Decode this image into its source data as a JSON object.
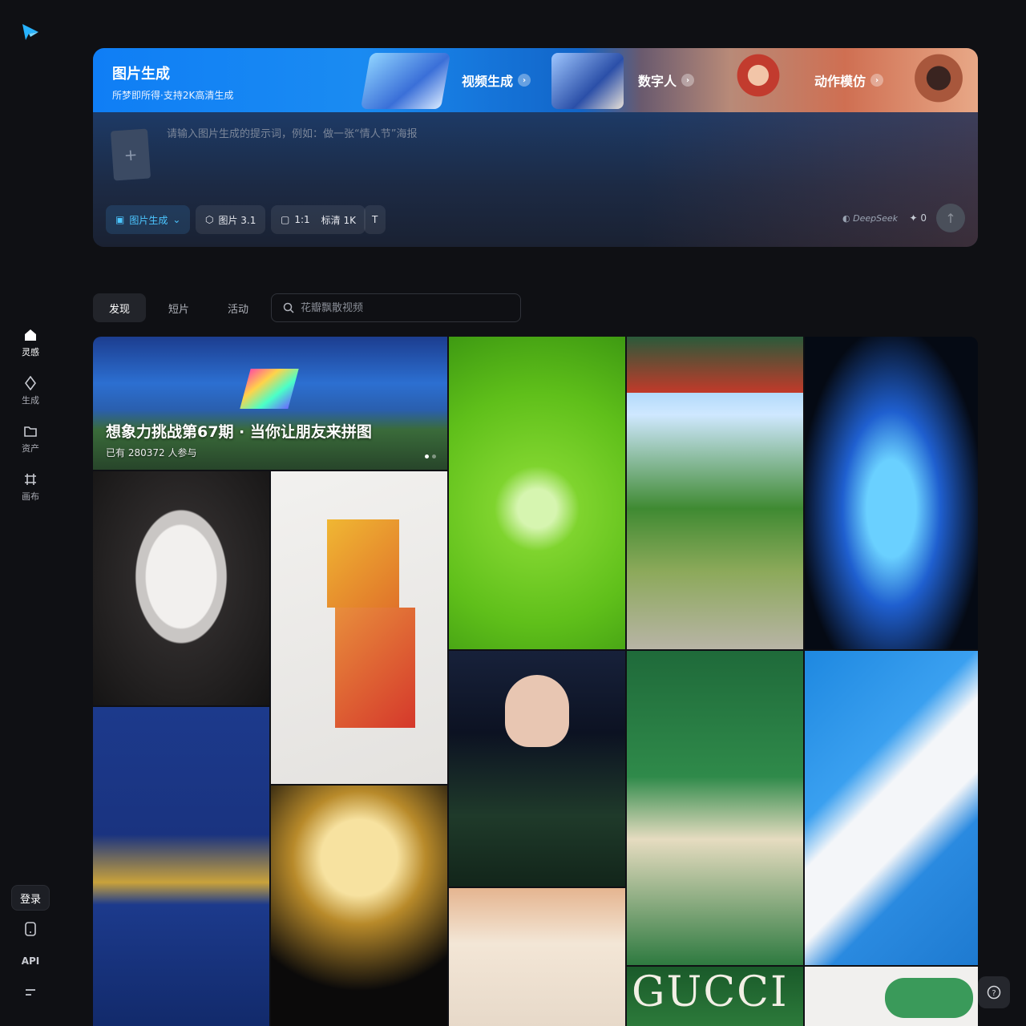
{
  "sidebar": {
    "items": [
      {
        "label": "灵感",
        "icon": "home-icon"
      },
      {
        "label": "生成",
        "icon": "sparkle-icon"
      },
      {
        "label": "资产",
        "icon": "folder-icon"
      },
      {
        "label": "画布",
        "icon": "canvas-icon"
      }
    ],
    "login": "登录",
    "api": "API"
  },
  "hero": {
    "main_tab": {
      "title": "图片生成",
      "subtitle": "所梦即所得·支持2K高清生成"
    },
    "tabs": [
      "视频生成",
      "数字人",
      "动作模仿"
    ],
    "prompt_placeholder": "请输入图片生成的提示词，例如：做一张“情人节”海报",
    "chips": {
      "mode": "图片生成",
      "model": "图片 3.1",
      "ratio": "1:1",
      "quality": "标清 1K"
    },
    "deepseek": "DeepSeek",
    "cost": "0"
  },
  "feed": {
    "tabs": [
      "发现",
      "短片",
      "活动"
    ],
    "search_placeholder": "花瓣飘散视频",
    "banner": {
      "title": "想象力挑战第67期 · 当你让朋友来拼图",
      "participants": "已有 280372 人参与"
    }
  },
  "colors": {
    "accent": "#4cc6ff",
    "background": "#0f1014"
  }
}
